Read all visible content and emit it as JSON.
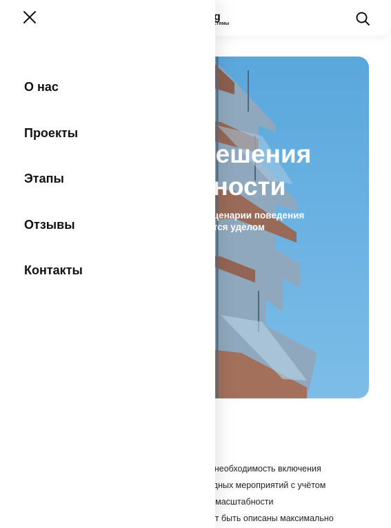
{
  "drawer": {
    "menu": [
      {
        "label": "О нас"
      },
      {
        "label": "Проекты"
      },
      {
        "label": "Этапы"
      },
      {
        "label": "Отзывы"
      },
      {
        "label": "Контакты"
      }
    ]
  },
  "header": {
    "logo_sub": "стемы"
  },
  "hero": {
    "title_line1": "решения",
    "title_line2": "кности",
    "subtitle_line1": "е сценарии поведения",
    "subtitle_line2": "аются уделом"
  },
  "body": {
    "lines": [
      "здаёт необходимость включения",
      "очередных мероприятий с учётом",
      "своей масштабности",
      "й могут быть описаны максимально"
    ]
  },
  "icons": {
    "close": "close-icon",
    "search": "search-icon"
  },
  "colors": {
    "sky": "#5aa7dc",
    "text": "#111111",
    "white": "#ffffff"
  }
}
